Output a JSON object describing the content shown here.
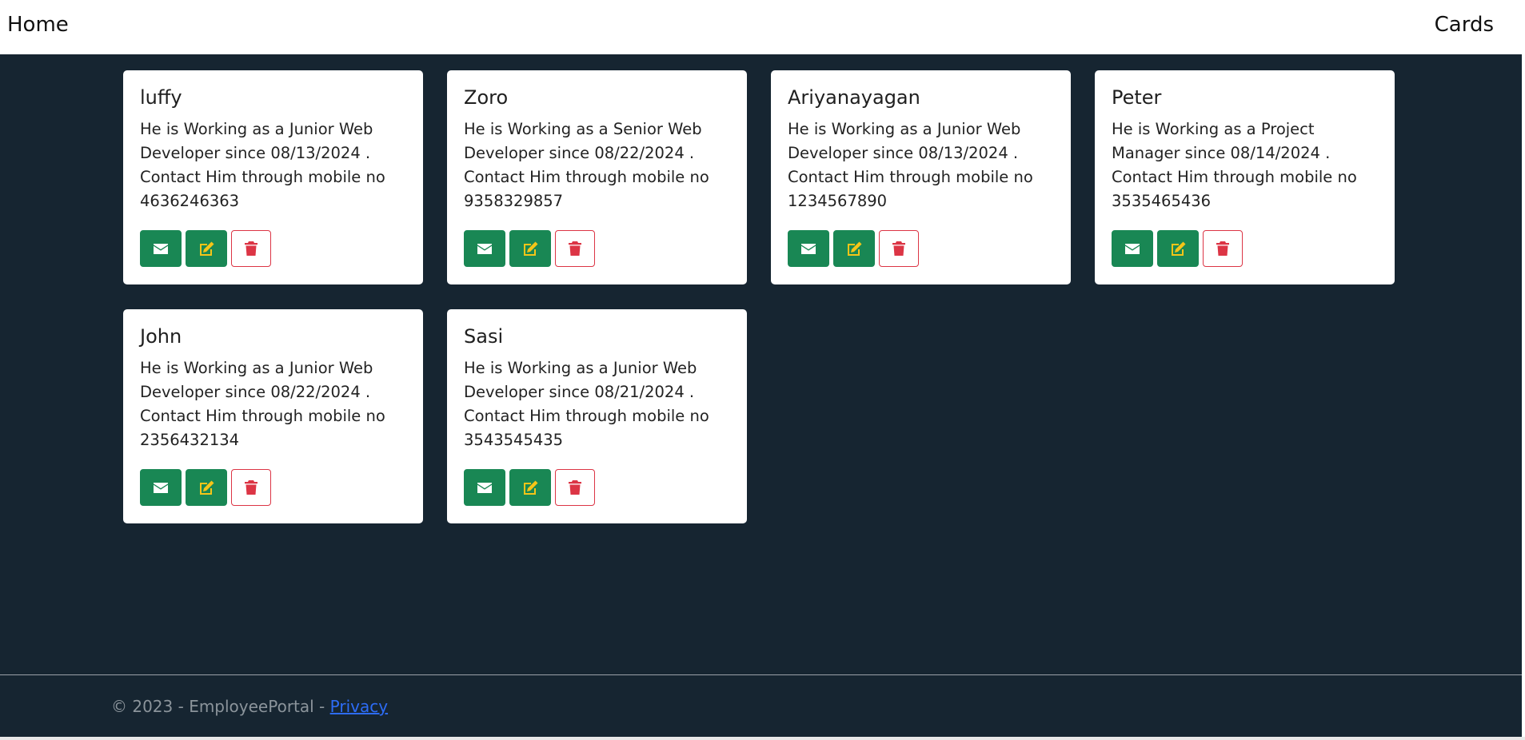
{
  "navbar": {
    "home_label": "Home",
    "cards_label": "Cards"
  },
  "icons": {
    "email": "envelope-icon",
    "edit": "edit-icon",
    "delete": "trash-icon"
  },
  "colors": {
    "background": "#162531",
    "button_green": "#198754",
    "edit_icon": "#f5c518",
    "delete_red": "#dc3545",
    "footer_link": "#2d6cf6"
  },
  "employees": [
    {
      "name": "luffy",
      "description": "He is Working as a Junior Web Developer since 08/13/2024 . Contact Him through mobile no 4636246363"
    },
    {
      "name": "Zoro",
      "description": "He is Working as a Senior Web Developer since 08/22/2024 . Contact Him through mobile no 9358329857"
    },
    {
      "name": "Ariyanayagan",
      "description": "He is Working as a Junior Web Developer since 08/13/2024 . Contact Him through mobile no 1234567890"
    },
    {
      "name": "Peter",
      "description": "He is Working as a Project Manager since 08/14/2024 . Contact Him through mobile no 3535465436"
    },
    {
      "name": "John",
      "description": "He is Working as a Junior Web Developer since 08/22/2024 . Contact Him through mobile no 2356432134"
    },
    {
      "name": "Sasi",
      "description": "He is Working as a Junior Web Developer since 08/21/2024 . Contact Him through mobile no 3543545435"
    }
  ],
  "footer": {
    "copyright": "© 2023 - EmployeePortal - ",
    "privacy_label": "Privacy"
  }
}
